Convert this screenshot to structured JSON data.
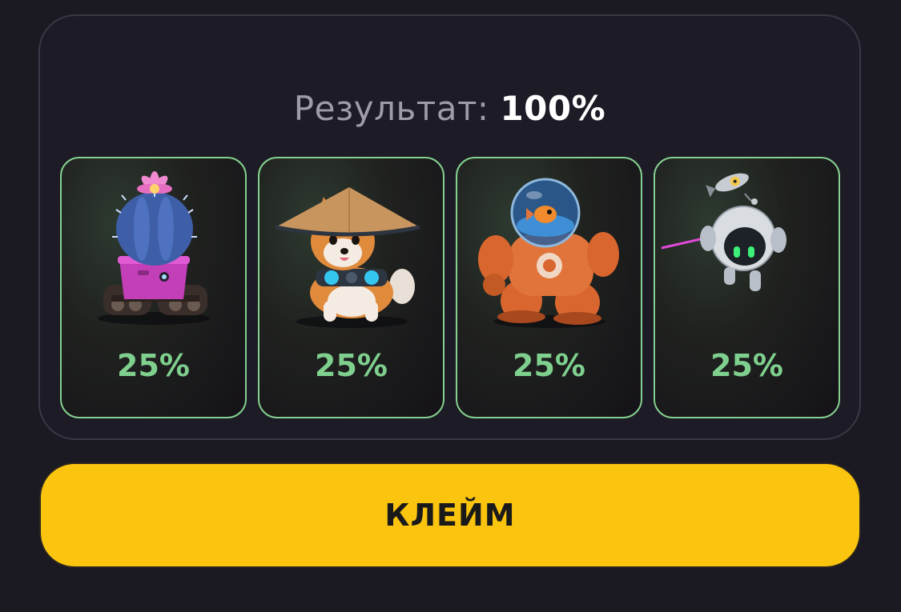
{
  "result": {
    "label": "Результат:",
    "value": "100%"
  },
  "cards": [
    {
      "name": "cactus-tank",
      "icon": "cactus-robot-icon",
      "percent": "25%"
    },
    {
      "name": "shiba-samurai",
      "icon": "shiba-dog-icon",
      "percent": "25%"
    },
    {
      "name": "fish-mech",
      "icon": "fish-mech-icon",
      "percent": "25%"
    },
    {
      "name": "drone-bot",
      "icon": "drone-robot-icon",
      "percent": "25%"
    }
  ],
  "claim_button": {
    "label": "КЛЕЙМ"
  },
  "colors": {
    "accent_yellow": "#fbc40e",
    "accent_green": "#7fd08e",
    "background": "#1b1921"
  }
}
